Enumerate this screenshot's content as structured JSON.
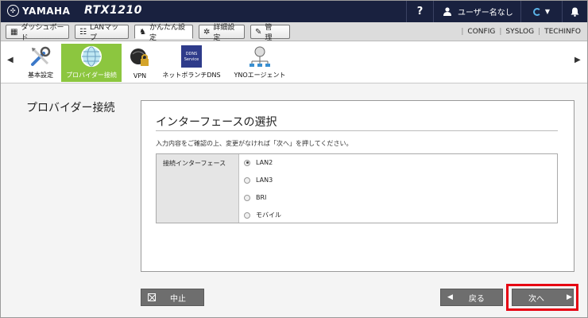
{
  "header": {
    "brand": "YAMAHA",
    "model": "RTX1210",
    "help": "?",
    "user": "ユーザー名なし"
  },
  "tabs": [
    {
      "label": "ダッシュボード",
      "icon": "dashboard-icon"
    },
    {
      "label": "LANマップ",
      "icon": "lan-map-icon"
    },
    {
      "label": "かんたん設定",
      "icon": "easy-setup-icon",
      "active": true
    },
    {
      "label": "詳細設定",
      "icon": "gear-icon"
    },
    {
      "label": "管　理",
      "icon": "wrench-icon"
    }
  ],
  "links": [
    "CONFIG",
    "SYSLOG",
    "TECHINFO"
  ],
  "icon_nav": [
    {
      "label": "基本設定",
      "icon": "tools-icon"
    },
    {
      "label": "プロバイダー接続",
      "icon": "globe-icon",
      "active": true
    },
    {
      "label": "VPN",
      "icon": "vpn-lock-icon"
    },
    {
      "label": "ネットボランチDNS",
      "icon": "ddns-service-icon"
    },
    {
      "label": "YNOエージェント",
      "icon": "network-agent-icon"
    }
  ],
  "ddns_icon_text": {
    "line1": "DDNS",
    "line2": "Service"
  },
  "page": {
    "title": "プロバイダー接続",
    "heading": "インターフェースの選択",
    "note": "入力内容をご確認の上、変更がなければ「次へ」を押してください。",
    "field_label": "接続インターフェース",
    "options": [
      "LAN2",
      "LAN3",
      "BRI",
      "モバイル"
    ],
    "selected": "LAN2"
  },
  "buttons": {
    "cancel": "中止",
    "back": "戻る",
    "next": "次へ"
  },
  "colors": {
    "topbar": "#19213f",
    "active_nav": "#8cc63f",
    "button": "#6e6e6e",
    "highlight": "#e60012"
  }
}
